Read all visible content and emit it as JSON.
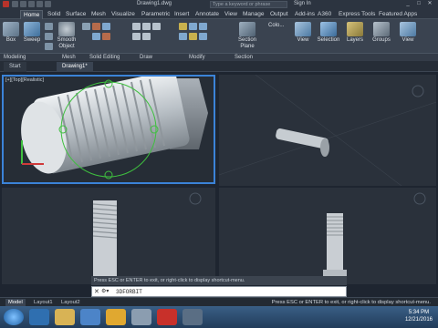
{
  "title_bar": {
    "document_title": "Drawing1.dwg",
    "search_placeholder": "Type a keyword or phrase",
    "sign_in": "Sign In",
    "minimize": "_",
    "maximize": "□",
    "close": "✕"
  },
  "ribbon_tabs": [
    "Home",
    "Solid",
    "Surface",
    "Mesh",
    "Visualize",
    "Parametric",
    "Insert",
    "Annotate",
    "View",
    "Manage",
    "Output",
    "Add-ins",
    "A360",
    "Express Tools",
    "Featured Apps"
  ],
  "ribbon_tools": {
    "box": "Box",
    "sweep": "Sweep",
    "smooth_object": "Smooth Object",
    "section_plane": "Section Plane",
    "view": "View",
    "selection": "Selection",
    "layers": "Layers",
    "groups": "Groups",
    "view2": "View",
    "color": "Colo..."
  },
  "panel_labels": [
    "Modeling",
    "Mesh",
    "Solid Editing",
    "Draw",
    "Modify",
    "Section"
  ],
  "file_tabs": [
    "Start",
    "Drawing1*"
  ],
  "viewport_label": "[+][Top][Realistic]",
  "command": {
    "history": "Press ESC or ENTER to exit, or right-click to display shortcut-menu.",
    "input": "3DFORBIT",
    "close_icon": "✕",
    "tool_icon": "⚙▾"
  },
  "layout_tabs": [
    "Model",
    "Layout1",
    "Layout2"
  ],
  "status_message": "Press ESC or ENTER to exit, or right-click to display shortcut-menu.",
  "clock": {
    "time": "5:34 PM",
    "date": "12/21/2016"
  }
}
